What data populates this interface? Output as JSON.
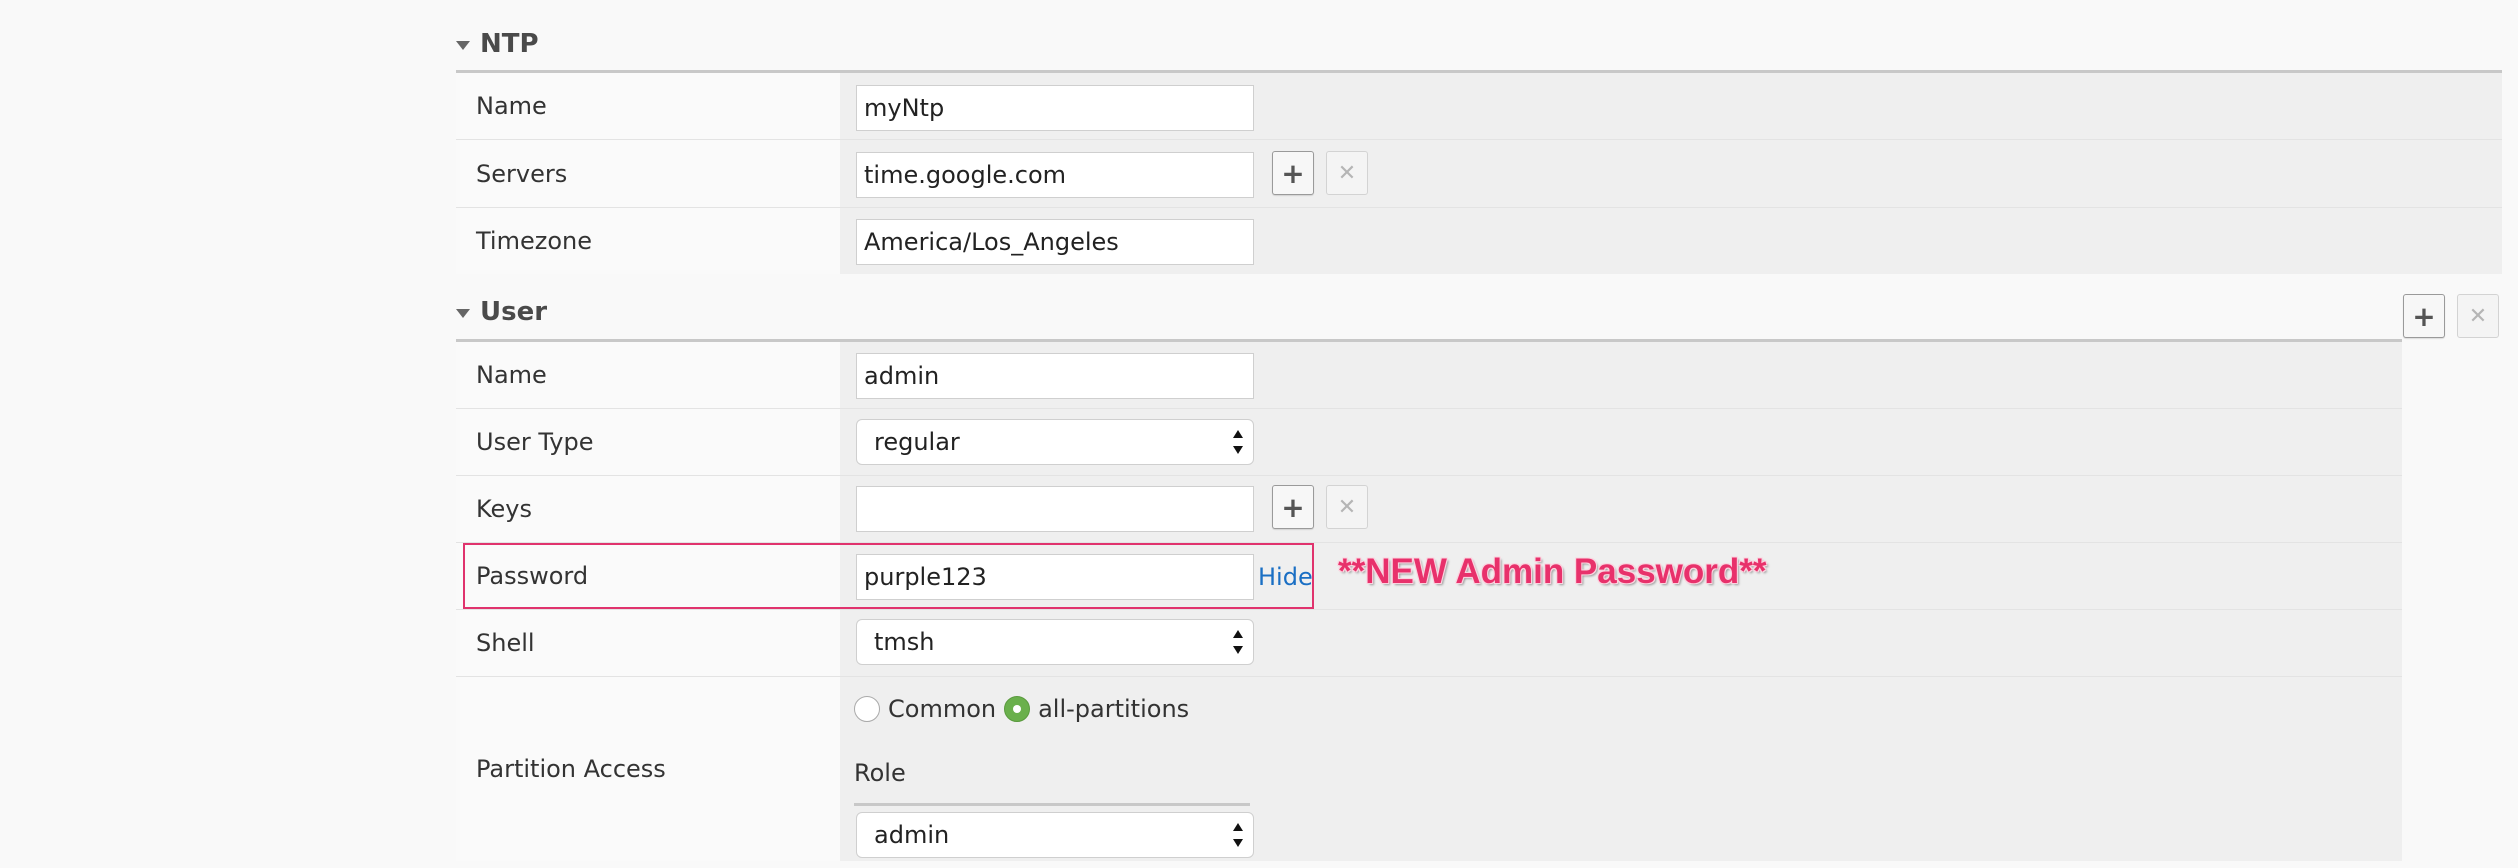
{
  "ntp": {
    "title": "NTP",
    "name_label": "Name",
    "name_value": "myNtp",
    "servers_label": "Servers",
    "servers_value": "time.google.com",
    "timezone_label": "Timezone",
    "timezone_value": "America/Los_Angeles",
    "add_symbol": "+",
    "remove_symbol": "✕"
  },
  "user": {
    "title": "User",
    "add_symbol": "+",
    "remove_symbol": "✕",
    "name_label": "Name",
    "name_value": "admin",
    "user_type_label": "User Type",
    "user_type_value": "regular",
    "keys_label": "Keys",
    "keys_value": "",
    "password_label": "Password",
    "password_value": "purple123",
    "password_toggle": "Hide",
    "shell_label": "Shell",
    "shell_value": "tmsh",
    "partition_label": "Partition Access",
    "partition_options": [
      "Common",
      "all-partitions"
    ],
    "partition_selected": "all-partitions",
    "role_label": "Role",
    "role_value": "admin"
  },
  "annotation": "**NEW Admin Password**",
  "colors": {
    "highlight": "#e0336d",
    "radio_selected": "#6ab04c",
    "link": "#1a6fc4"
  }
}
